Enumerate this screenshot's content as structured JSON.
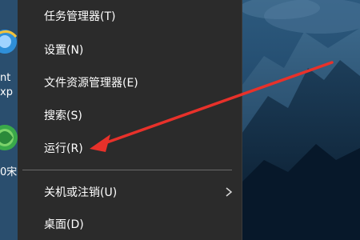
{
  "desktop": {
    "icons": [
      {
        "name": "internet-explorer-icon",
        "label_line1": "nt",
        "label_line2": "xp"
      },
      {
        "name": "360-app-icon",
        "label_line1": "0宋"
      }
    ],
    "wallpaper": "mountain-night-sky"
  },
  "context_menu": {
    "items": [
      {
        "label": "任务管理器(T)",
        "name": "menu-item-task-manager"
      },
      {
        "label": "设置(N)",
        "name": "menu-item-settings"
      },
      {
        "label": "文件资源管理器(E)",
        "name": "menu-item-file-explorer"
      },
      {
        "label": "搜索(S)",
        "name": "menu-item-search"
      },
      {
        "label": "运行(R)",
        "name": "menu-item-run"
      },
      {
        "label": "关机或注销(U)",
        "name": "menu-item-shutdown-signout",
        "has_submenu": true
      },
      {
        "label": "桌面(D)",
        "name": "menu-item-desktop"
      }
    ]
  },
  "annotation": {
    "type": "arrow",
    "color": "#e8312a",
    "target": "menu-item-run"
  },
  "colors": {
    "menu_bg": "#2b2b2b",
    "menu_text": "#ffffff",
    "separator": "#6a6a6a",
    "arrow": "#e8312a"
  }
}
